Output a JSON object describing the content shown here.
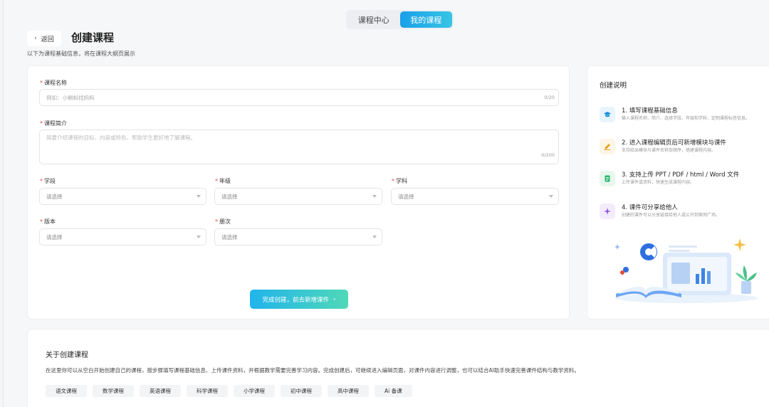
{
  "tabs": [
    {
      "label": "课程中心",
      "active": false
    },
    {
      "label": "我的课程",
      "active": true
    }
  ],
  "header": {
    "back_label": "返回",
    "title": "创建课程",
    "subtitle": "以下为课程基础信息，将在课程大纲页展示"
  },
  "form": {
    "name": {
      "label": "课程名称",
      "placeholder": "例如：小蝌蚪找妈妈",
      "counter": "0/20"
    },
    "intro": {
      "label": "课程简介",
      "placeholder": "简要介绍课程的目标、内容或特色，帮助学生更好地了解课程。",
      "counter": "0/200"
    },
    "stage": {
      "label": "学段",
      "placeholder": "请选择"
    },
    "grade": {
      "label": "年级",
      "placeholder": "请选择"
    },
    "subject": {
      "label": "学科",
      "placeholder": "请选择"
    },
    "edition": {
      "label": "版本",
      "placeholder": "请选择"
    },
    "volume": {
      "label": "册次",
      "placeholder": "请选择"
    },
    "submit_label": "完成创建，前去新增课件"
  },
  "info": {
    "title": "创建说明",
    "steps": [
      {
        "title": "1. 填写课程基础信息",
        "desc": "输入课程名称、简介、选择学段、年级和学科，定制课程标签信息。",
        "icon": "graduation-cap-icon",
        "color": "#1a8fd8",
        "bg": "#e8f4fd"
      },
      {
        "title": "2. 进入课程编辑页后可新增模块与课件",
        "desc": "支持给出模块与课件名称及顺序，搭建课程内容。",
        "icon": "pencil-icon",
        "color": "#f0a020",
        "bg": "#fdf5e6"
      },
      {
        "title": "3. 支持上传 PPT / PDF / html / Word 文件",
        "desc": "上传课件或资料，快速生成课程内容。",
        "icon": "document-icon",
        "color": "#27b36a",
        "bg": "#e7f7ee"
      },
      {
        "title": "4. 课件可分享给他人",
        "desc": "创建的课件可以分享链接给他人或公开到案例广场。",
        "icon": "sparkle-icon",
        "color": "#8b4be0",
        "bg": "#f3ecfd"
      }
    ]
  },
  "about": {
    "title": "关于创建课程",
    "desc": "在这里你可以从空白开始创建自己的课程，按步骤填写课程基础信息、上传课件资料，并根据教学需要完善学习内容。完成创建后，可继续进入编辑页面，对课件内容进行调整，也可以结合AI助手快速完善课件结构与教学资料。",
    "tags": [
      "语文课程",
      "数学课程",
      "英语课程",
      "科学课程",
      "小学课程",
      "初中课程",
      "高中课程",
      "Ai 备课"
    ]
  }
}
